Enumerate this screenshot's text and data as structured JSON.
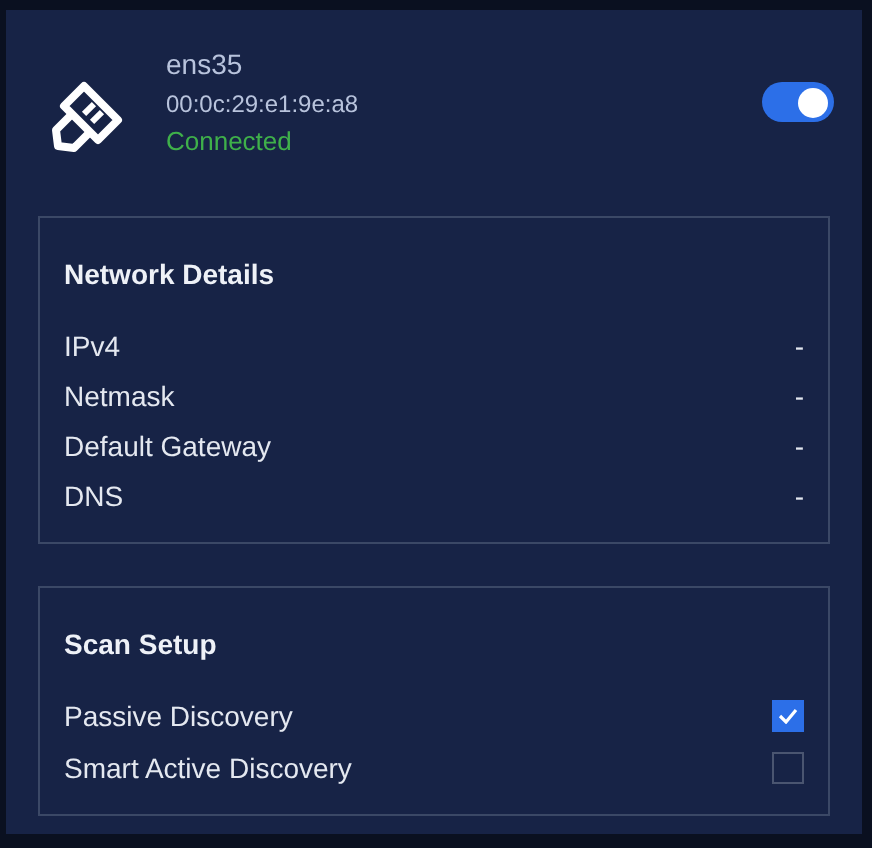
{
  "interface": {
    "name": "ens35",
    "mac": "00:0c:29:e1:9e:a8",
    "status": "Connected",
    "connected": true,
    "on": true
  },
  "network_details": {
    "title": "Network Details",
    "rows": [
      {
        "label": "IPv4",
        "value": "-"
      },
      {
        "label": "Netmask",
        "value": "-"
      },
      {
        "label": "Default Gateway",
        "value": "-"
      },
      {
        "label": "DNS",
        "value": "-"
      }
    ]
  },
  "scan_setup": {
    "title": "Scan Setup",
    "options": [
      {
        "label": "Passive Discovery",
        "checked": true
      },
      {
        "label": "Smart Active Discovery",
        "checked": false
      }
    ]
  }
}
